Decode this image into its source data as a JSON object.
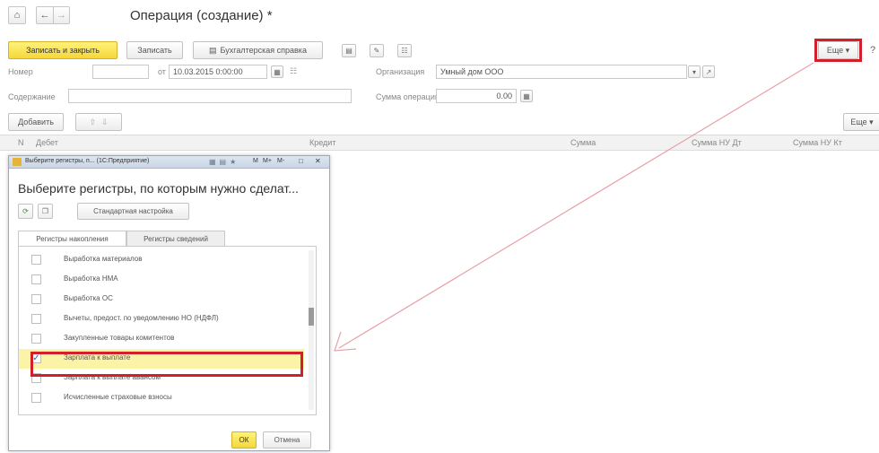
{
  "header": {
    "title": "Операция (создание) *",
    "home_icon": "home-icon",
    "back_icon": "arrow-left-icon",
    "forward_icon": "arrow-right-icon"
  },
  "toolbar": {
    "save_close_label": "Записать и закрыть",
    "save_label": "Записать",
    "report_label": "Бухгалтерская справка",
    "more_label": "Еще ▾",
    "help_label": "?"
  },
  "form": {
    "number_label": "Номер",
    "number_value": "",
    "date_from_label": "от",
    "date_value": "10.03.2015  0:00:00",
    "organization_label": "Организация",
    "organization_value": "Умный дом ООО",
    "content_label": "Содержание",
    "content_value": "",
    "amount_label": "Сумма операции",
    "amount_value": "0.00"
  },
  "table_toolbar": {
    "add_label": "Добавить",
    "more_label": "Еще ▾"
  },
  "table": {
    "columns": [
      "N",
      "Дебет",
      "Кредит",
      "Сумма",
      "Сумма НУ Дт",
      "Сумма НУ Кт"
    ]
  },
  "dialog": {
    "window_title": "Выберите регистры, п...  (1С:Предприятие)",
    "window_controls": [
      "M",
      "M+",
      "M-",
      "□",
      "✕"
    ],
    "heading": "Выберите регистры, по которым нужно сделат...",
    "standard_settings_label": "Стандартная настройка",
    "tabs": [
      "Регистры накопления",
      "Регистры сведений"
    ],
    "items": [
      {
        "label": "Выработка материалов",
        "checked": false
      },
      {
        "label": "Выработка НМА",
        "checked": false
      },
      {
        "label": "Выработка ОС",
        "checked": false
      },
      {
        "label": "Вычеты, предост. по уведомлению НО (НДФЛ)",
        "checked": false
      },
      {
        "label": "Закупленные товары комитентов",
        "checked": false
      },
      {
        "label": "Зарплата к выплате",
        "checked": true
      },
      {
        "label": "Зарплата к выплате авансом",
        "checked": false
      },
      {
        "label": "Исчисленные страховые взносы",
        "checked": false
      }
    ],
    "ok_label": "ОК",
    "cancel_label": "Отмена"
  },
  "colors": {
    "highlight": "#d2202a",
    "arrow": "#e8a0a8",
    "primary_button": "#f5d73a",
    "selected_row": "#fbf3a6"
  }
}
